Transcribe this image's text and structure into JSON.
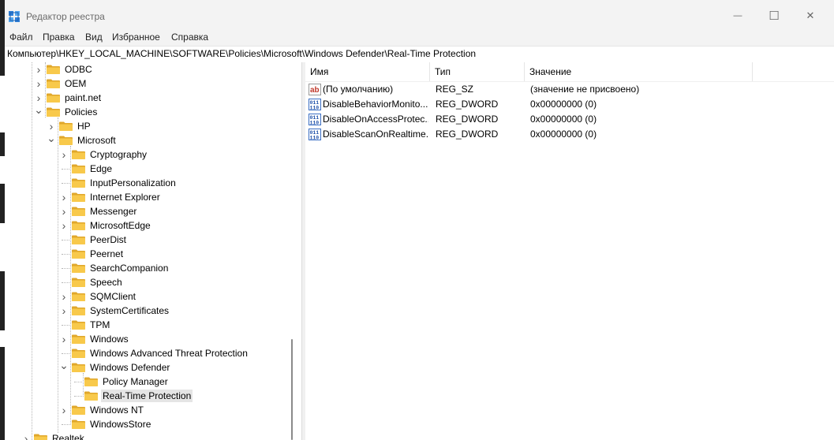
{
  "window": {
    "title": "Редактор реестра",
    "controls": {
      "minimize": "—",
      "maximize": "☐",
      "close": "✕"
    }
  },
  "menu": [
    "Файл",
    "Правка",
    "Вид",
    "Избранное",
    "Справка"
  ],
  "address": "Компьютер\\HKEY_LOCAL_MACHINE\\SOFTWARE\\Policies\\Microsoft\\Windows Defender\\Real-Time Protection",
  "tree": [
    {
      "label": "ODBC",
      "expander": "collapsed"
    },
    {
      "label": "OEM",
      "expander": "collapsed"
    },
    {
      "label": "paint.net",
      "expander": "collapsed"
    },
    {
      "label": "Policies",
      "expander": "expanded"
    },
    {
      "label": "HP",
      "expander": "collapsed"
    },
    {
      "label": "Microsoft",
      "expander": "expanded"
    },
    {
      "label": "Cryptography",
      "expander": "collapsed"
    },
    {
      "label": "Edge",
      "expander": "none"
    },
    {
      "label": "InputPersonalization",
      "expander": "none"
    },
    {
      "label": "Internet Explorer",
      "expander": "collapsed"
    },
    {
      "label": "Messenger",
      "expander": "collapsed"
    },
    {
      "label": "MicrosoftEdge",
      "expander": "collapsed"
    },
    {
      "label": "PeerDist",
      "expander": "none"
    },
    {
      "label": "Peernet",
      "expander": "none"
    },
    {
      "label": "SearchCompanion",
      "expander": "none"
    },
    {
      "label": "Speech",
      "expander": "none"
    },
    {
      "label": "SQMClient",
      "expander": "collapsed"
    },
    {
      "label": "SystemCertificates",
      "expander": "collapsed"
    },
    {
      "label": "TPM",
      "expander": "none"
    },
    {
      "label": "Windows",
      "expander": "collapsed"
    },
    {
      "label": "Windows Advanced Threat Protection",
      "expander": "none"
    },
    {
      "label": "Windows Defender",
      "expander": "expanded"
    },
    {
      "label": "Policy Manager",
      "expander": "none"
    },
    {
      "label": "Real-Time Protection",
      "expander": "none",
      "selected": true
    },
    {
      "label": "Windows NT",
      "expander": "collapsed"
    },
    {
      "label": "WindowsStore",
      "expander": "none"
    },
    {
      "label": "Realtek",
      "expander": "collapsed"
    }
  ],
  "list": {
    "columns": [
      "Имя",
      "Тип",
      "Значение"
    ],
    "rows": [
      {
        "icon": "string-value-icon",
        "name": "(По умолчанию)",
        "type": "REG_SZ",
        "data": "(значение не присвоено)"
      },
      {
        "icon": "dword-value-icon",
        "name": "DisableBehaviorMonito...",
        "type": "REG_DWORD",
        "data": "0x00000000 (0)"
      },
      {
        "icon": "dword-value-icon",
        "name": "DisableOnAccessProtec...",
        "type": "REG_DWORD",
        "data": "0x00000000 (0)"
      },
      {
        "icon": "dword-value-icon",
        "name": "DisableScanOnRealtime...",
        "type": "REG_DWORD",
        "data": "0x00000000 (0)"
      }
    ]
  },
  "colors": {
    "folder": "#f8c94b",
    "folder_dark": "#e0a72b",
    "selection": "#e5e5e5",
    "titlebar": "#f3f3f3"
  }
}
